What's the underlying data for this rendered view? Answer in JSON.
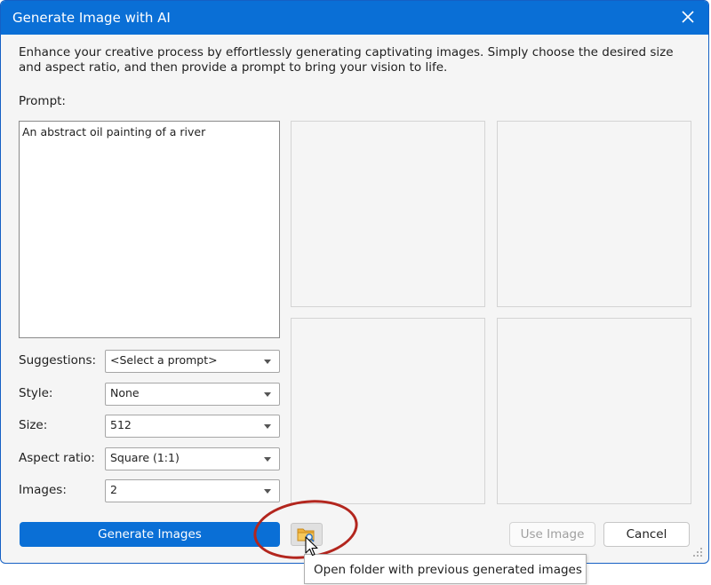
{
  "window": {
    "title": "Generate Image with AI"
  },
  "description": "Enhance your creative process by effortlessly generating captivating images. Simply choose the desired size and aspect ratio, and then provide a prompt to bring your vision to life.",
  "prompt": {
    "label": "Prompt:",
    "value": "An abstract oil painting of a river"
  },
  "fields": {
    "suggestions": {
      "label": "Suggestions:",
      "value": "<Select a prompt>"
    },
    "style": {
      "label": "Style:",
      "value": "None"
    },
    "size": {
      "label": "Size:",
      "value": "512"
    },
    "aspect_ratio": {
      "label": "Aspect ratio:",
      "value": "Square (1:1)"
    },
    "images": {
      "label": "Images:",
      "value": "2"
    }
  },
  "buttons": {
    "generate": "Generate Images",
    "use_image": "Use Image",
    "cancel": "Cancel"
  },
  "tooltip": "Open folder with previous generated images",
  "colors": {
    "accent": "#0a6fd6",
    "annotation": "#b3261e"
  },
  "icons": {
    "close": "close-icon",
    "folder": "folder-search-icon",
    "dropdown": "chevron-down-icon",
    "grip": "resize-grip-icon",
    "cursor": "mouse-pointer-icon"
  }
}
